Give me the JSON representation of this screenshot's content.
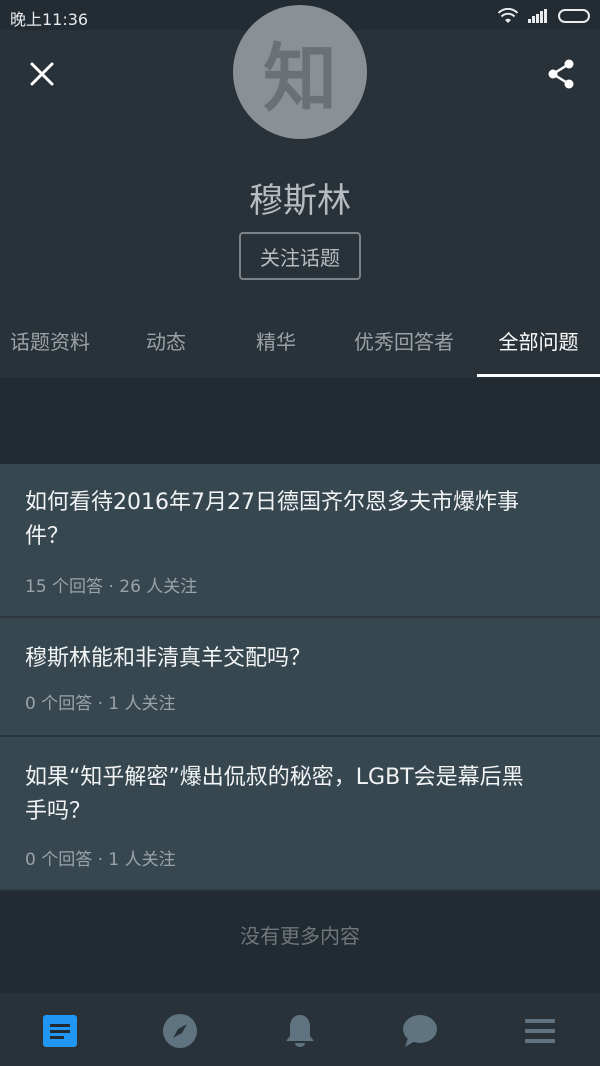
{
  "status": {
    "time": "晚上11:36"
  },
  "header": {
    "avatar_text": "知",
    "topic_name": "穆斯林",
    "follow_label": "关注话题"
  },
  "tabs": [
    {
      "label": "话题资料"
    },
    {
      "label": "动态"
    },
    {
      "label": "精华"
    },
    {
      "label": "优秀回答者"
    },
    {
      "label": "全部问题",
      "active": true
    }
  ],
  "questions": [
    {
      "title_line1": "如何看待2016年7月27日德国齐尔恩多夫市爆炸事",
      "title_line2": "件？",
      "meta": "15 个回答 · 26 人关注"
    },
    {
      "title_line1": "穆斯林能和非清真羊交配吗？",
      "meta": "0 个回答 · 1 人关注"
    },
    {
      "title_line1": "如果“知乎解密”爆出侃叔的秘密，LGBT会是幕后黑",
      "title_line2": "手吗？",
      "meta": "0 个回答 · 1 人关注"
    }
  ],
  "footer": {
    "no_more": "没有更多内容"
  },
  "bottom_nav": [
    {
      "icon": "feed-icon",
      "active": true
    },
    {
      "icon": "explore-compass-icon"
    },
    {
      "icon": "notification-bell-icon"
    },
    {
      "icon": "message-chat-icon"
    },
    {
      "icon": "menu-icon"
    }
  ],
  "colors": {
    "background": "#222b31",
    "header": "#283238",
    "card": "#37474f",
    "accent": "#2196f3"
  }
}
